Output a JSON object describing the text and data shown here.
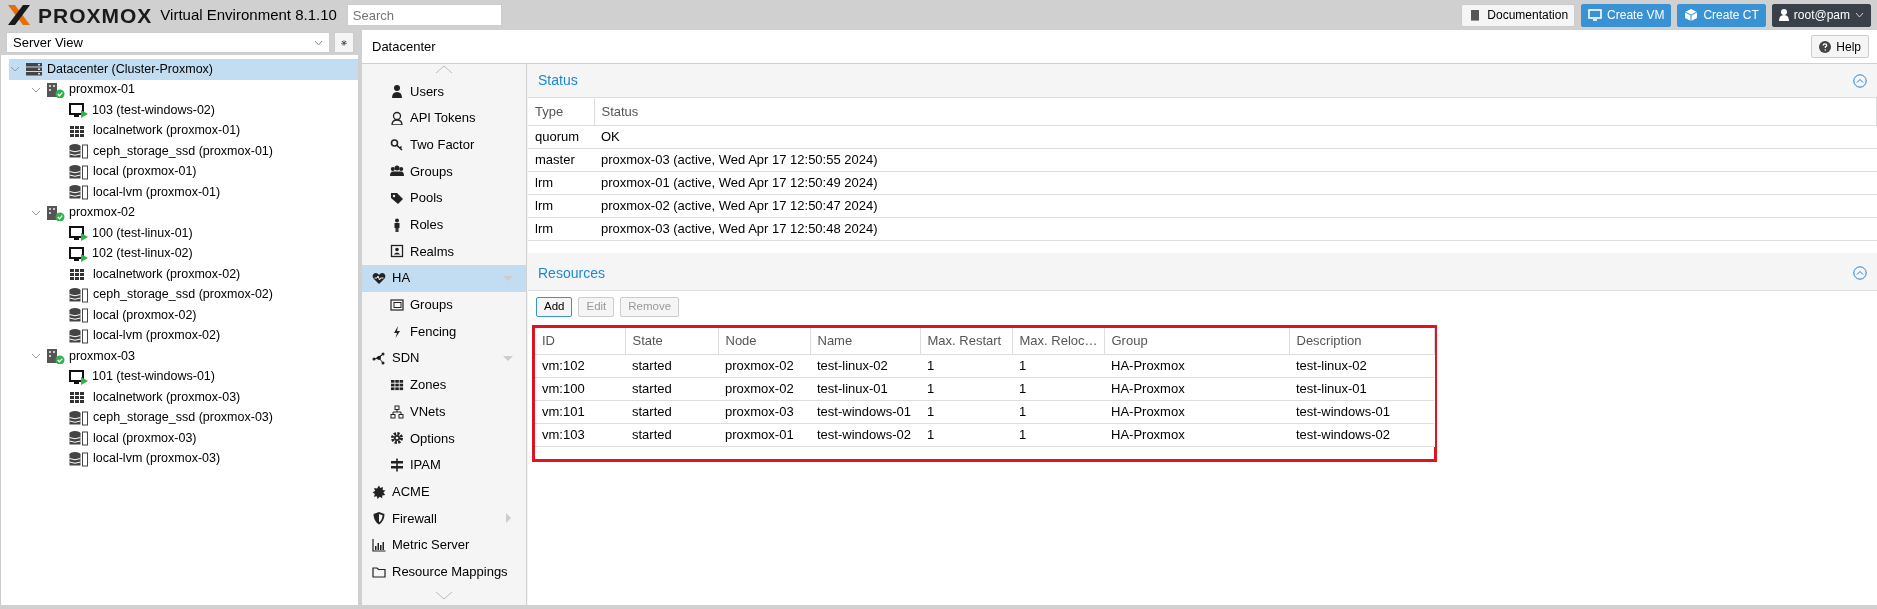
{
  "header": {
    "logo": "PROXMOX",
    "product": "Virtual Environment 8.1.10",
    "search": {
      "placeholder": "Search"
    },
    "buttons": [
      {
        "label": "Documentation",
        "kind": "doc"
      },
      {
        "label": "Create VM",
        "kind": "vm"
      },
      {
        "label": "Create CT",
        "kind": "ct"
      }
    ],
    "user": "root@pam"
  },
  "view_selector": {
    "value": "Server View"
  },
  "tree": [
    {
      "label": "Datacenter (Cluster-Proxmox)",
      "kind": "datacenter",
      "selected": true,
      "expanded": true,
      "children": [
        {
          "label": "proxmox-01",
          "kind": "node",
          "selected": false,
          "expanded": true,
          "children": [
            {
              "label": "103 (test-windows-02)",
              "kind": "vm",
              "selected": false
            },
            {
              "label": "localnetwork (proxmox-01)",
              "kind": "network",
              "selected": false
            },
            {
              "label": "ceph_storage_ssd (proxmox-01)",
              "kind": "storage",
              "selected": false
            },
            {
              "label": "local (proxmox-01)",
              "kind": "storage",
              "selected": false
            },
            {
              "label": "local-lvm (proxmox-01)",
              "kind": "storage",
              "selected": false
            }
          ]
        },
        {
          "label": "proxmox-02",
          "kind": "node",
          "selected": false,
          "expanded": true,
          "children": [
            {
              "label": "100 (test-linux-01)",
              "kind": "vm",
              "selected": false
            },
            {
              "label": "102 (test-linux-02)",
              "kind": "vm",
              "selected": false
            },
            {
              "label": "localnetwork (proxmox-02)",
              "kind": "network",
              "selected": false
            },
            {
              "label": "ceph_storage_ssd (proxmox-02)",
              "kind": "storage",
              "selected": false
            },
            {
              "label": "local (proxmox-02)",
              "kind": "storage",
              "selected": false
            },
            {
              "label": "local-lvm (proxmox-02)",
              "kind": "storage",
              "selected": false
            }
          ]
        },
        {
          "label": "proxmox-03",
          "kind": "node",
          "selected": false,
          "expanded": true,
          "children": [
            {
              "label": "101 (test-windows-01)",
              "kind": "vm",
              "selected": false
            },
            {
              "label": "localnetwork (proxmox-03)",
              "kind": "network",
              "selected": false
            },
            {
              "label": "ceph_storage_ssd (proxmox-03)",
              "kind": "storage",
              "selected": false
            },
            {
              "label": "local (proxmox-03)",
              "kind": "storage",
              "selected": false
            },
            {
              "label": "local-lvm (proxmox-03)",
              "kind": "storage",
              "selected": false
            }
          ]
        }
      ]
    }
  ],
  "breadcrumb": "Datacenter",
  "help_button": "Help",
  "menu": [
    {
      "children": [
        {
          "label": "Users",
          "selected": false
        },
        {
          "label": "API Tokens",
          "selected": false
        },
        {
          "label": "Two Factor",
          "selected": false
        },
        {
          "label": "Groups",
          "selected": false
        },
        {
          "label": "Pools",
          "selected": false
        },
        {
          "label": "Roles",
          "selected": false
        },
        {
          "label": "Realms",
          "selected": false
        }
      ]
    },
    {
      "label": "HA",
      "selected": true,
      "expanded": true,
      "children": [
        {
          "label": "Groups",
          "selected": false
        },
        {
          "label": "Fencing",
          "selected": false
        }
      ]
    },
    {
      "label": "SDN",
      "selected": false,
      "expanded": true,
      "children": [
        {
          "label": "Zones",
          "selected": false
        },
        {
          "label": "VNets",
          "selected": false
        },
        {
          "label": "Options",
          "selected": false
        },
        {
          "label": "IPAM",
          "selected": false
        }
      ]
    },
    {
      "label": "ACME",
      "selected": false
    },
    {
      "label": "Firewall",
      "selected": false,
      "expanded": false
    },
    {
      "label": "Metric Server",
      "selected": false
    },
    {
      "label": "Resource Mappings",
      "selected": false
    }
  ],
  "status_panel": {
    "title": "Status",
    "columns": [
      "Type",
      "Status"
    ],
    "rows": [
      [
        "quorum",
        "OK"
      ],
      [
        "master",
        "proxmox-03 (active, Wed Apr 17 12:50:55 2024)"
      ],
      [
        "lrm",
        "proxmox-01 (active, Wed Apr 17 12:50:49 2024)"
      ],
      [
        "lrm",
        "proxmox-02 (active, Wed Apr 17 12:50:47 2024)"
      ],
      [
        "lrm",
        "proxmox-03 (active, Wed Apr 17 12:50:48 2024)"
      ]
    ]
  },
  "resources_panel": {
    "title": "Resources",
    "toolbar": [
      {
        "label": "Add",
        "disabled": false
      },
      {
        "label": "Edit",
        "disabled": true
      },
      {
        "label": "Remove",
        "disabled": true
      }
    ],
    "columns": [
      "ID",
      "State",
      "Node",
      "Name",
      "Max. Restart",
      "Max. Reloc…",
      "Group",
      "Description"
    ],
    "rows": [
      [
        "vm:102",
        "started",
        "proxmox-02",
        "test-linux-02",
        "1",
        "1",
        "HA-Proxmox",
        "test-linux-02"
      ],
      [
        "vm:100",
        "started",
        "proxmox-02",
        "test-linux-01",
        "1",
        "1",
        "HA-Proxmox",
        "test-linux-01"
      ],
      [
        "vm:101",
        "started",
        "proxmox-03",
        "test-windows-01",
        "1",
        "1",
        "HA-Proxmox",
        "test-windows-01"
      ],
      [
        "vm:103",
        "started",
        "proxmox-01",
        "test-windows-02",
        "1",
        "1",
        "HA-Proxmox",
        "test-windows-02"
      ]
    ]
  }
}
